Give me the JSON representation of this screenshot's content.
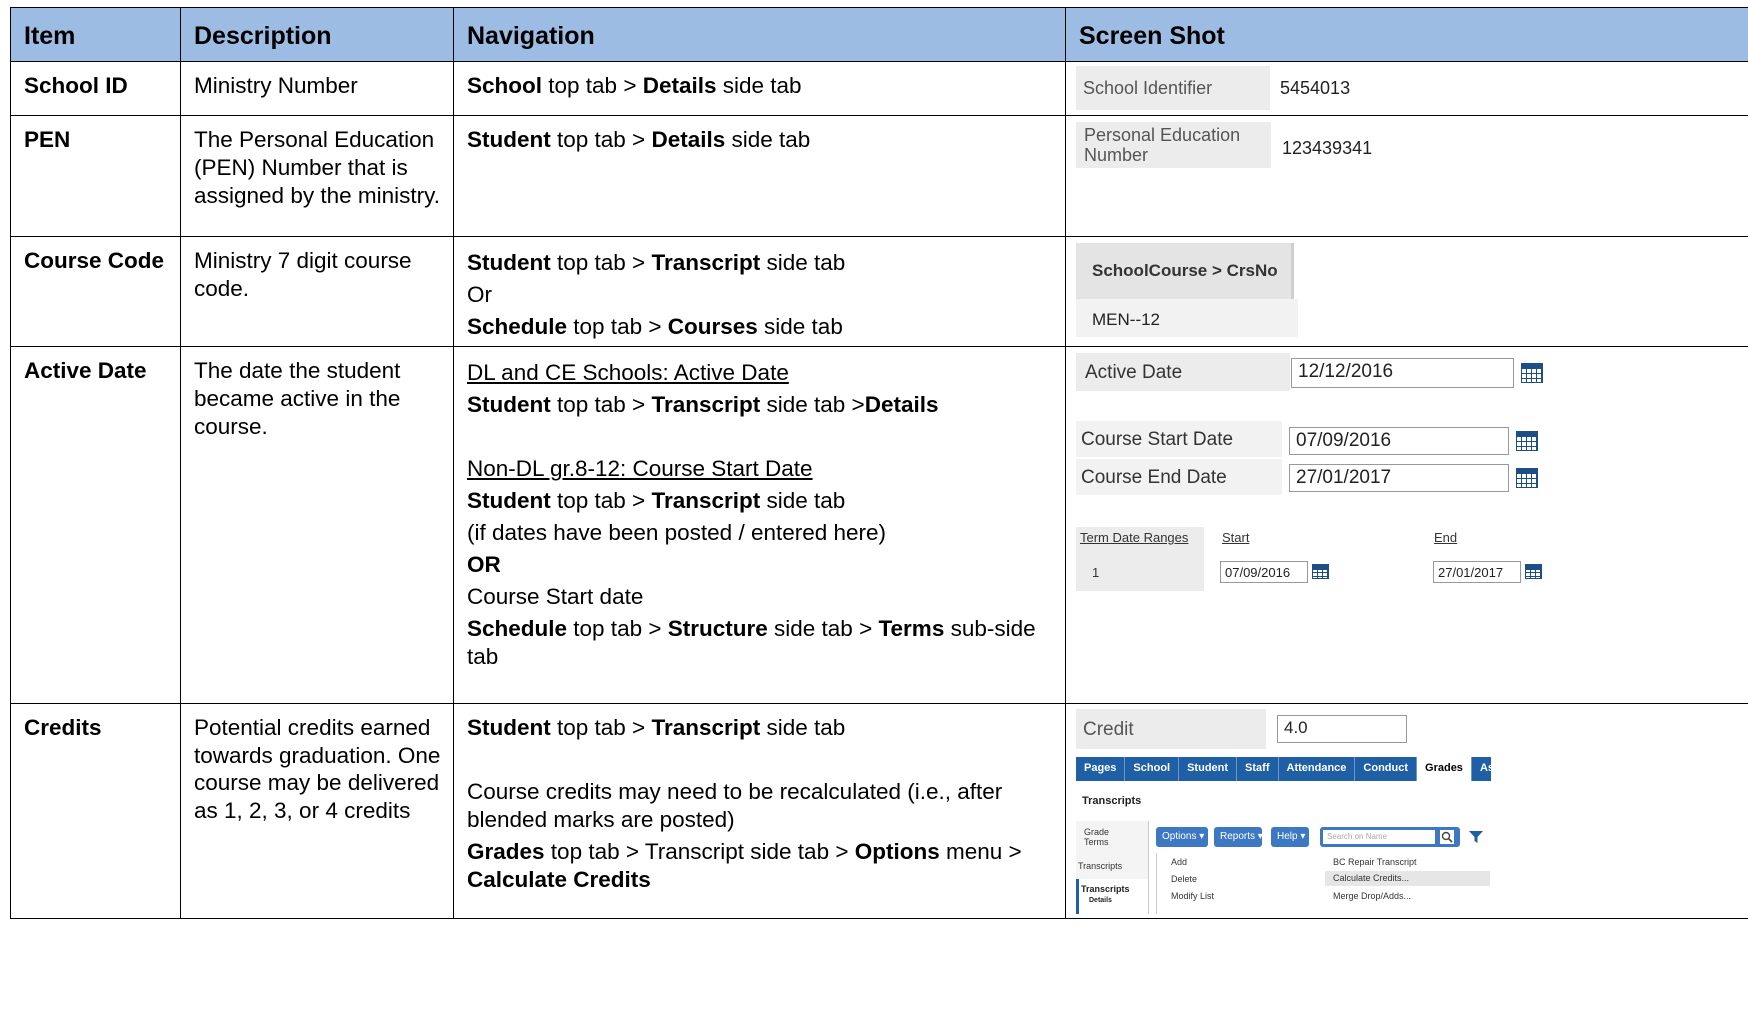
{
  "headers": {
    "item": "Item",
    "description": "Description",
    "navigation": "Navigation",
    "screenshot": "Screen Shot"
  },
  "rows": {
    "school_id": {
      "item": "School ID",
      "description": "Ministry Number",
      "nav": {
        "b1": "School",
        "t1": " top tab > ",
        "b2": "Details",
        "t2": " side tab"
      },
      "shot": {
        "label": "School Identifier",
        "value": "5454013"
      }
    },
    "pen": {
      "item": "PEN",
      "description": "The Personal Education (PEN) Number that is assigned by the ministry.",
      "nav": {
        "b1": "Student",
        "t1": " top tab > ",
        "b2": "Details",
        "t2": " side tab"
      },
      "shot": {
        "label": "Personal Education Number",
        "value": "123439341"
      }
    },
    "course_code": {
      "item": "Course Code",
      "description": "Ministry 7 digit course code.",
      "nav": {
        "l1": {
          "b1": "Student",
          "t1": " top tab > ",
          "b2": "Transcript",
          "t2": " side tab"
        },
        "or": "Or",
        "l2": {
          "b1": "Schedule",
          "t1": " top tab > ",
          "b2": "Courses",
          "t2": " side tab"
        }
      },
      "shot": {
        "header": "SchoolCourse > CrsNo",
        "value": "MEN--12"
      }
    },
    "active_date": {
      "item": "Active Date",
      "description": "The date the student became active in the course.",
      "nav": {
        "u1": "DL and CE Schools: Active Date",
        "l1": {
          "b1": "Student",
          "t1": " top tab > ",
          "b2": "Transcript",
          "t2": " side tab >",
          "b3": "Details"
        },
        "u2": "Non-DL gr.8-12:  Course Start Date",
        "l2": {
          "b1": "Student",
          "t1": " top tab > ",
          "b2": "Transcript",
          "t2": " side tab"
        },
        "note": "(if dates have been posted / entered here)",
        "or": "OR",
        "plain": "Course Start date",
        "l3": {
          "b1": "Schedule",
          "t1": " top tab > ",
          "b2": "Structure",
          "t2": " side tab > ",
          "b3": "Terms",
          "t3": " sub-side tab"
        }
      },
      "shot": {
        "active_label": "Active Date",
        "active_value": "12/12/2016",
        "start_label": "Course Start Date",
        "start_value": "07/09/2016",
        "end_label": "Course End Date",
        "end_value": "27/01/2017",
        "term_header": "Term Date Ranges",
        "start_header": "Start",
        "end_header": "End",
        "term_no": "1",
        "term_start": "07/09/2016",
        "term_end": "27/01/2017"
      }
    },
    "credits": {
      "item": "Credits",
      "description": "Potential credits earned towards graduation. One course may be delivered as 1, 2, 3, or 4 credits",
      "nav": {
        "l1": {
          "b1": "Student",
          "t1": " top tab > ",
          "b2": "Transcript",
          "t2": " side tab"
        },
        "p2": "Course credits may need to be recalculated (i.e., after blended marks are posted)",
        "l3": {
          "b1": "Grades",
          "t1": " top tab > Transcript side tab > ",
          "b2": "Options",
          "t2": " menu > ",
          "b3": "Calculate Credits"
        }
      },
      "shot": {
        "credit_label": "Credit",
        "credit_value": "4.0",
        "tabs": [
          "Pages",
          "School",
          "Student",
          "Staff",
          "Attendance",
          "Conduct",
          "Grades",
          "Assess"
        ],
        "page_title": "Transcripts",
        "side_grade_terms": "Grade Terms",
        "side_transcripts": "Transcripts",
        "side_transcripts_bold": "Transcripts",
        "side_details": "Details",
        "btn_options": "Options ▾",
        "btn_reports": "Reports ▾",
        "btn_help": "Help ▾",
        "search_placeholder": "Search on Name",
        "menu_add": "Add",
        "menu_delete": "Delete",
        "menu_modify": "Modify List",
        "menu_repair": "BC Repair Transcript",
        "menu_calc": "Calculate Credits...",
        "menu_merge": "Merge Drop/Adds..."
      }
    }
  }
}
